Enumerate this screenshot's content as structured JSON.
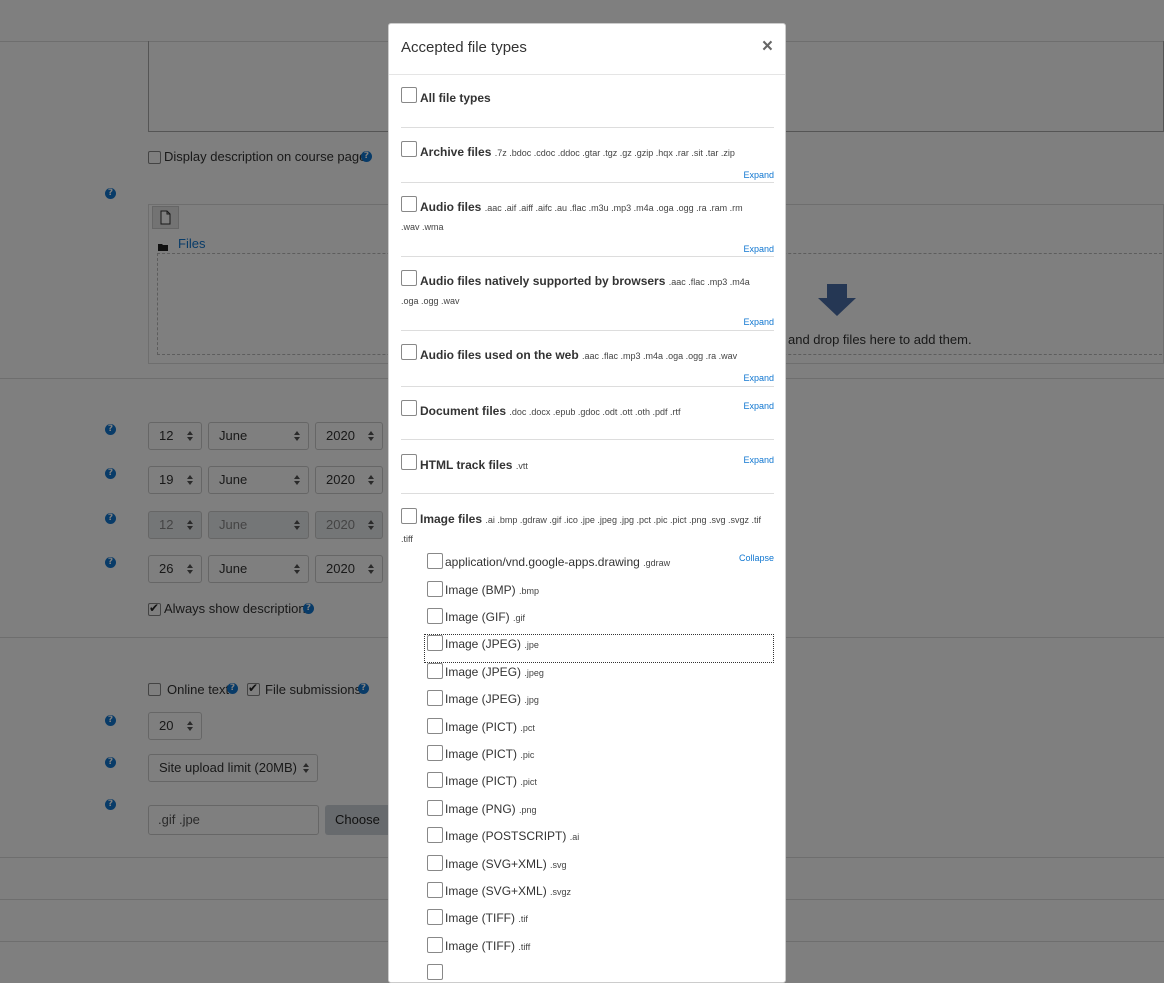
{
  "background": {
    "display_description_label": "Display description on course page",
    "files_label": "Files",
    "drop_text": "and drop files here to add them.",
    "dates": [
      {
        "day": "12",
        "month": "June",
        "year": "2020",
        "disabled": false
      },
      {
        "day": "19",
        "month": "June",
        "year": "2020",
        "disabled": false
      },
      {
        "day": "12",
        "month": "June",
        "year": "2020",
        "disabled": true
      },
      {
        "day": "26",
        "month": "June",
        "year": "2020",
        "disabled": false
      }
    ],
    "always_show_description_label": "Always show description",
    "online_text_label": "Online text",
    "file_submissions_label": "File submissions",
    "max_files_value": "20",
    "upload_limit_value": "Site upload limit (20MB)",
    "file_types_value": ".gif .jpe",
    "choose_button": "Choose"
  },
  "modal": {
    "title": "Accepted file types",
    "close": "×",
    "all_file_types": "All file types",
    "expand_label": "Expand",
    "collapse_label": "Collapse",
    "groups": [
      {
        "name": "Archive files",
        "exts": ".7z .bdoc .cdoc .ddoc .gtar .tgz .gz .gzip .hqx .rar .sit .tar .zip"
      },
      {
        "name": "Audio files",
        "exts": ".aac .aif .aiff .aifc .au .flac .m3u .mp3 .m4a .oga .ogg .ra .ram .rm .wav .wma"
      },
      {
        "name": "Audio files natively supported by browsers",
        "exts": ".aac .flac .mp3 .m4a .oga .ogg .wav"
      },
      {
        "name": "Audio files used on the web",
        "exts": ".aac .flac .mp3 .m4a .oga .ogg .ra .wav"
      },
      {
        "name": "Document files",
        "exts": ".doc .docx .epub .gdoc .odt .ott .oth .pdf .rtf"
      },
      {
        "name": "HTML track files",
        "exts": ".vtt"
      },
      {
        "name": "Image files",
        "exts": ".ai .bmp .gdraw .gif .ico .jpe .jpeg .jpg .pct .pic .pict .png .svg .svgz .tif .tiff"
      }
    ],
    "image_types": [
      {
        "name": "application/vnd.google-apps.drawing",
        "ext": ".gdraw"
      },
      {
        "name": "Image (BMP)",
        "ext": ".bmp"
      },
      {
        "name": "Image (GIF)",
        "ext": ".gif"
      },
      {
        "name": "Image (JPEG)",
        "ext": ".jpe"
      },
      {
        "name": "Image (JPEG)",
        "ext": ".jpeg"
      },
      {
        "name": "Image (JPEG)",
        "ext": ".jpg"
      },
      {
        "name": "Image (PICT)",
        "ext": ".pct"
      },
      {
        "name": "Image (PICT)",
        "ext": ".pic"
      },
      {
        "name": "Image (PICT)",
        "ext": ".pict"
      },
      {
        "name": "Image (PNG)",
        "ext": ".png"
      },
      {
        "name": "Image (POSTSCRIPT)",
        "ext": ".ai"
      },
      {
        "name": "Image (SVG+XML)",
        "ext": ".svg"
      },
      {
        "name": "Image (SVG+XML)",
        "ext": ".svgz"
      },
      {
        "name": "Image (TIFF)",
        "ext": ".tif"
      },
      {
        "name": "Image (TIFF)",
        "ext": ".tiff"
      }
    ]
  }
}
